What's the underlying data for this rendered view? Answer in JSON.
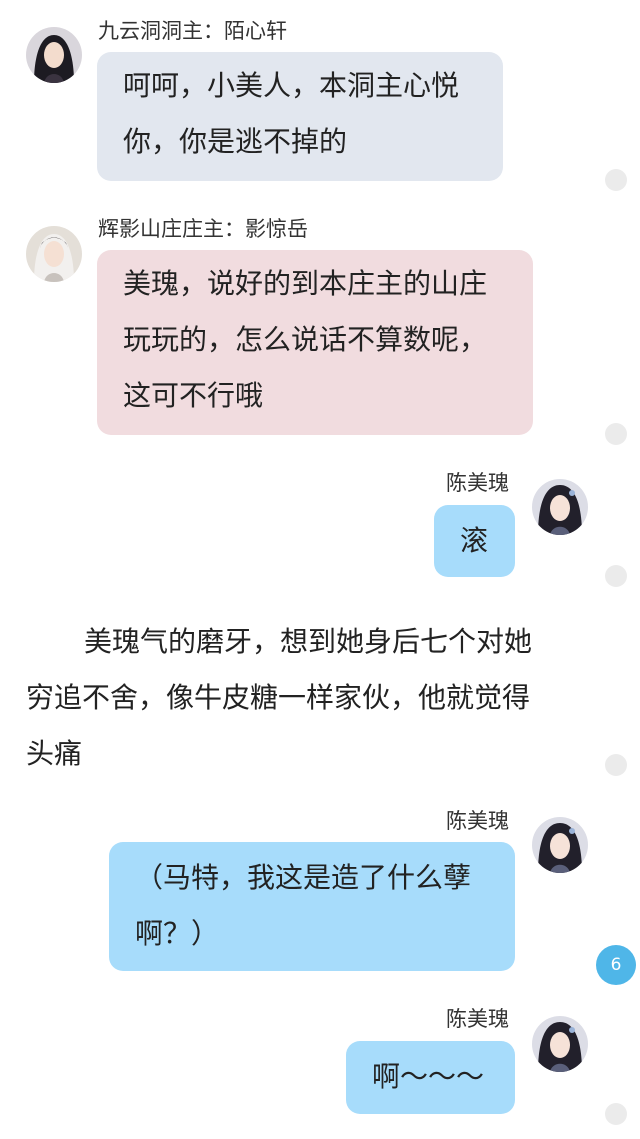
{
  "messages": [
    {
      "sender": "九云洞洞主：陌心轩",
      "text_lines": [
        "呵呵，小美人，本洞主心悦",
        "你，你是逃不掉的"
      ],
      "avatar_icon": "male-dark-hair-avatar",
      "side": "left",
      "color": "#e2e7ef"
    },
    {
      "sender": "辉影山庄庄主：影惊岳",
      "text_lines": [
        "美瑰，说好的到本庄主的山庄",
        "玩玩的，怎么说话不算数呢，",
        "这可不行哦"
      ],
      "avatar_icon": "male-white-hair-avatar",
      "side": "left",
      "color": "#f1dcdf"
    },
    {
      "sender": "陈美瑰",
      "text_lines": [
        "滚"
      ],
      "avatar_icon": "female-avatar",
      "side": "right",
      "color": "#a7dcfb"
    },
    {
      "sender": "陈美瑰",
      "text_lines": [
        "（马特，我这是造了什么孽",
        "啊？）"
      ],
      "avatar_icon": "female-avatar",
      "side": "right",
      "color": "#a7dcfb"
    },
    {
      "sender": "陈美瑰",
      "text_lines": [
        "啊～～～"
      ],
      "avatar_icon": "female-avatar",
      "side": "right",
      "color": "#a7dcfb"
    }
  ],
  "narration": {
    "lines": [
      "美瑰气的磨牙，想到她身后七个对她",
      "穷追不舍，像牛皮糖一样家伙，他就觉得",
      "头痛"
    ]
  },
  "comment_badge": {
    "count": "6"
  }
}
